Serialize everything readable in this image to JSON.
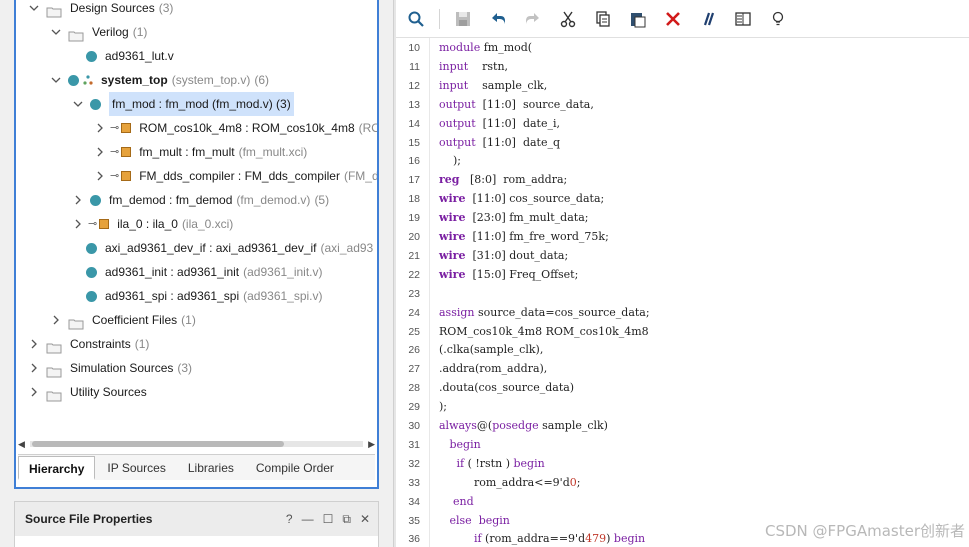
{
  "tree": {
    "design_sources": {
      "label": "Design Sources",
      "count": "(3)"
    },
    "verilog": {
      "label": "Verilog",
      "count": "(1)"
    },
    "ad9361_lut": {
      "label": "ad9361_lut.v"
    },
    "system_top": {
      "label": "system_top",
      "file": "(system_top.v)",
      "count": "(6)"
    },
    "fm_mod": {
      "label": "fm_mod : fm_mod (fm_mod.v) (3)"
    },
    "rom_cos": {
      "label": "ROM_cos10k_4m8 : ROM_cos10k_4m8",
      "file": "(RO"
    },
    "fm_mult": {
      "label": "fm_mult : fm_mult",
      "file": "(fm_mult.xci)"
    },
    "fm_dds": {
      "label": "FM_dds_compiler : FM_dds_compiler",
      "file": "(FM_d"
    },
    "fm_demod": {
      "label": "fm_demod : fm_demod",
      "file": "(fm_demod.v)",
      "count": "(5)"
    },
    "ila_0": {
      "label": "ila_0 : ila_0",
      "file": "(ila_0.xci)"
    },
    "axi_ad9361": {
      "label": "axi_ad9361_dev_if : axi_ad9361_dev_if",
      "file": "(axi_ad93"
    },
    "ad9361_init": {
      "label": "ad9361_init : ad9361_init",
      "file": "(ad9361_init.v)"
    },
    "ad9361_spi": {
      "label": "ad9361_spi : ad9361_spi",
      "file": "(ad9361_spi.v)"
    },
    "coefficient": {
      "label": "Coefficient Files",
      "count": "(1)"
    },
    "constraints": {
      "label": "Constraints",
      "count": "(1)"
    },
    "simulation": {
      "label": "Simulation Sources",
      "count": "(3)"
    },
    "utility": {
      "label": "Utility Sources"
    }
  },
  "tabs": [
    "Hierarchy",
    "IP Sources",
    "Libraries",
    "Compile Order"
  ],
  "props": {
    "title": "Source File Properties",
    "help": "?",
    "min": "—",
    "max": "☐",
    "float": "⧉",
    "close": "✕"
  },
  "toolbar_icons": [
    "search-icon",
    "save-icon",
    "undo-icon",
    "redo-icon",
    "cut-icon",
    "copy-icon",
    "paste-icon",
    "delete-icon",
    "comment-icon",
    "columns-icon",
    "lightbulb-icon"
  ],
  "code": {
    "line_numbers": [
      "10",
      "11",
      "12",
      "13",
      "14",
      "15",
      "16",
      "17",
      "18",
      "19",
      "20",
      "21",
      "22",
      "23",
      "24",
      "25",
      "26",
      "27",
      "28",
      "29",
      "30",
      "31",
      "32",
      "33",
      "34",
      "35",
      "36"
    ],
    "lines": [
      "module fm_mod(",
      "input    rstn,",
      "input    sample_clk,",
      "output  [11:0]  source_data,",
      "output  [11:0]  date_i,",
      "output  [11:0]  date_q",
      "    );",
      "reg   [8:0]  rom_addra;",
      "wire  [11:0] cos_source_data;",
      "wire  [23:0] fm_mult_data;",
      "wire  [11:0] fm_fre_word_75k;",
      "wire  [31:0] dout_data;",
      "wire  [15:0] Freq_Offset;",
      "",
      "assign source_data=cos_source_data;",
      "ROM_cos10k_4m8 ROM_cos10k_4m8",
      "(.clka(sample_clk),",
      ".addra(rom_addra),",
      ".douta(cos_source_data)",
      ");",
      "always@(posedge sample_clk)",
      "   begin",
      "     if ( !rstn ) begin",
      "          rom_addra<=9'd0;",
      "    end",
      "   else  begin",
      "          if (rom_addra==9'd479) begin"
    ]
  },
  "watermark": "CSDN @FPGAmaster创新者"
}
